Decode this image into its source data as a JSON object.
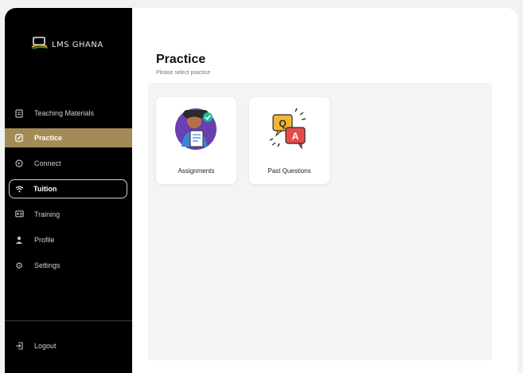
{
  "app": {
    "brand": "LMS GHANA"
  },
  "sidebar": {
    "items": [
      {
        "label": "Teaching Materials",
        "icon": "book-icon",
        "state": "normal"
      },
      {
        "label": "Practice",
        "icon": "edit-icon",
        "state": "active"
      },
      {
        "label": "Connect",
        "icon": "chat-icon",
        "state": "normal"
      },
      {
        "label": "Tuition",
        "icon": "wifi-icon",
        "state": "outlined"
      },
      {
        "label": "Training",
        "icon": "training-icon",
        "state": "normal"
      },
      {
        "label": "Profile",
        "icon": "person-icon",
        "state": "normal"
      },
      {
        "label": "Settings",
        "icon": "gear-icon",
        "state": "normal"
      }
    ],
    "logout": {
      "label": "Logout",
      "icon": "logout-icon"
    }
  },
  "main": {
    "title": "Practice",
    "subtitle": "Please select practice",
    "cards": [
      {
        "label": "Assignments",
        "icon": "assignment-person-icon"
      },
      {
        "label": "Past Questions",
        "icon": "qa-bubbles-icon"
      }
    ]
  },
  "colors": {
    "sidebar_bg": "#000000",
    "active_bg": "#a48a57",
    "panel_bg": "#f4f4f4"
  }
}
